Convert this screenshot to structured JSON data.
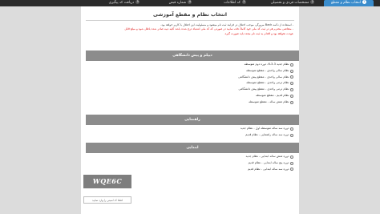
{
  "tabs": [
    {
      "num": "1",
      "label": "انتخاب نظام و مقطع",
      "active": true
    },
    {
      "num": "2",
      "label": "مشخصات فردی و تحصیلی",
      "active": false
    },
    {
      "num": "3",
      "label": "کد اطلاعات",
      "active": false
    },
    {
      "num": "4",
      "label": "شماره قبض",
      "active": false
    },
    {
      "num": "5",
      "label": "دریافت کد پیگیری",
      "active": false
    }
  ],
  "title": "انتخاب نظام و مقطع آموزشی",
  "intro": {
    "line1": "- استفاده از دکمه Back مرورگر، موجب اختلال در فرایند ثبت نام میشود و مسئولیت این اختلال با کاربر خواهد بود.",
    "line2": "- متقاضی محترم هر در ثبت کد ملی خود کاملاً دقت نمایید در صورتی که کد ملی اشتباه درج شده باشد کلیه دبیه صادر شده باطل شود و مبلغ قابل",
    "line3": "عودت نخواهد بود و اقدام به ثبت نام مجدد باید صورت گیرد."
  },
  "sections": [
    {
      "heading": "دیپلم و پیش دانشگاهی",
      "options": [
        "نظام جدید 3-3-6، دوره دوم متوسطه",
        "نظام سالی واحدی - مقطع متوسطه",
        "نظام سالی واحدی - مقطع پیش دانشگاهی",
        "نظام ترمی واحدی - مقطع متوسطه",
        "نظام ترمی واحدی - مقطع پیش دانشگاهی",
        "نظام قدیم - مقطع متوسطه",
        "نظام شش ساله - مقطع متوسطه"
      ]
    },
    {
      "heading": "راهنمایی",
      "options": [
        "دوره سه ساله متوسطه اول - نظام جدید",
        "دوره سه ساله راهنمایی - نظام قدیم"
      ]
    },
    {
      "heading": "ابتدایی",
      "options": [
        "دوره شش ساله ابتدایی - نظام جدید",
        "دوره پنج ساله ابتدایی - نظام قدیم",
        "دوره سه ساله ابتدایی - نظام قدیم"
      ]
    }
  ],
  "captcha": {
    "text": "WQE6C",
    "placeholder": "لطفا کد امنیتی را وارد نمایید"
  }
}
